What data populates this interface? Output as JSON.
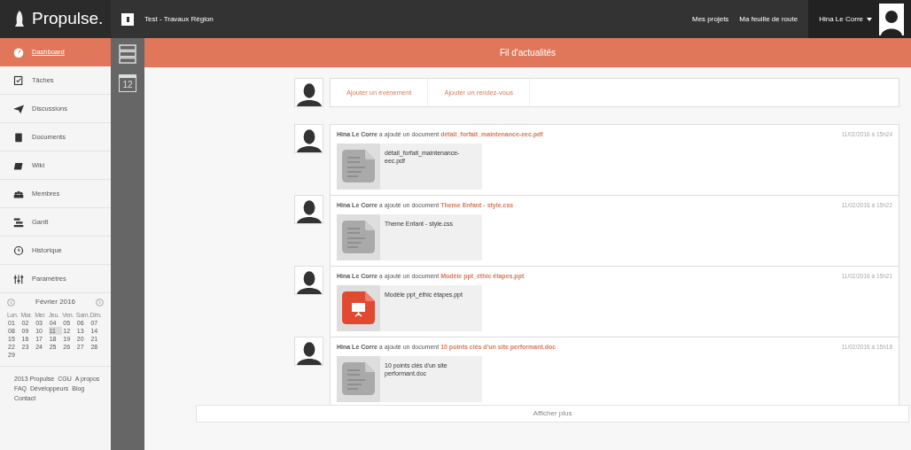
{
  "topbar": {
    "logo": "Propulse.",
    "project": "Test - Travaux Région",
    "links": [
      "Mes projets",
      "Ma feuille de route"
    ],
    "user": "Hina Le Corre"
  },
  "sidebar": {
    "items": [
      {
        "label": "Dashboard",
        "selected": true
      },
      {
        "label": "Tâches",
        "selected": false
      },
      {
        "label": "Discussions",
        "selected": false
      },
      {
        "label": "Documents",
        "selected": false
      },
      {
        "label": "Wiki",
        "selected": false
      },
      {
        "label": "Membres",
        "selected": false
      },
      {
        "label": "Gantt",
        "selected": false
      },
      {
        "label": "Historique",
        "selected": false
      },
      {
        "label": "Paramètres",
        "selected": false
      }
    ]
  },
  "calendar": {
    "month": "Février 2016",
    "weekdays": [
      "Lun.",
      "Mar.",
      "Mer.",
      "Jeu.",
      "Ven.",
      "Sam.",
      "Dim."
    ],
    "days": [
      {
        "label": "01",
        "selected": false
      },
      {
        "label": "02",
        "selected": false
      },
      {
        "label": "03",
        "selected": false
      },
      {
        "label": "04",
        "selected": false
      },
      {
        "label": "05",
        "selected": false
      },
      {
        "label": "06",
        "selected": false
      },
      {
        "label": "07",
        "selected": false
      },
      {
        "label": "08",
        "selected": false
      },
      {
        "label": "09",
        "selected": false
      },
      {
        "label": "10",
        "selected": false
      },
      {
        "label": "11",
        "selected": true
      },
      {
        "label": "12",
        "selected": false
      },
      {
        "label": "13",
        "selected": false
      },
      {
        "label": "14",
        "selected": false
      },
      {
        "label": "15",
        "selected": false
      },
      {
        "label": "16",
        "selected": false
      },
      {
        "label": "17",
        "selected": false
      },
      {
        "label": "18",
        "selected": false
      },
      {
        "label": "19",
        "selected": false
      },
      {
        "label": "20",
        "selected": false
      },
      {
        "label": "21",
        "selected": false
      },
      {
        "label": "22",
        "selected": false
      },
      {
        "label": "23",
        "selected": false
      },
      {
        "label": "24",
        "selected": false
      },
      {
        "label": "25",
        "selected": false
      },
      {
        "label": "26",
        "selected": false
      },
      {
        "label": "27",
        "selected": false
      },
      {
        "label": "28",
        "selected": false
      },
      {
        "label": "29",
        "selected": false
      }
    ]
  },
  "footer_links": [
    "2013 Propulse",
    "CGU",
    "A propos",
    "FAQ",
    "Développeurs",
    "Blog",
    "Contact"
  ],
  "icon_strip": {
    "calendar_day": "12"
  },
  "header": {
    "title": "Fil d'actualités"
  },
  "composer": {
    "actions": [
      "Ajouter un événement",
      "Ajouter un rendez-vous"
    ]
  },
  "feed": [
    {
      "author": "Hina Le Corre",
      "action": "a ajouté un document",
      "file": "détail_forfait_maintenance-eec.pdf",
      "time": "11/02/2016 à 15h24",
      "preview_name": "détail_forfait_maintenance-eec.pdf",
      "kind": "document"
    },
    {
      "author": "Hina Le Corre",
      "action": "a ajouté un document",
      "file": "Theme Enfant - style.css",
      "time": "11/02/2016 à 15h22",
      "preview_name": "Theme Enfant - style.css",
      "kind": "document"
    },
    {
      "author": "Hina Le Corre",
      "action": "a ajouté un document",
      "file": "Modèle ppt_éthic étapes.ppt",
      "time": "11/02/2016 à 15h21",
      "preview_name": "Modèle ppt_éthic étapes.ppt",
      "kind": "presentation"
    },
    {
      "author": "Hina Le Corre",
      "action": "a ajouté un document",
      "file": "10 points clés d'un site performant.doc",
      "time": "11/02/2016 à 15h18",
      "preview_name": "10 points clés d'un site performant.doc",
      "kind": "document"
    }
  ],
  "more": "Afficher plus"
}
